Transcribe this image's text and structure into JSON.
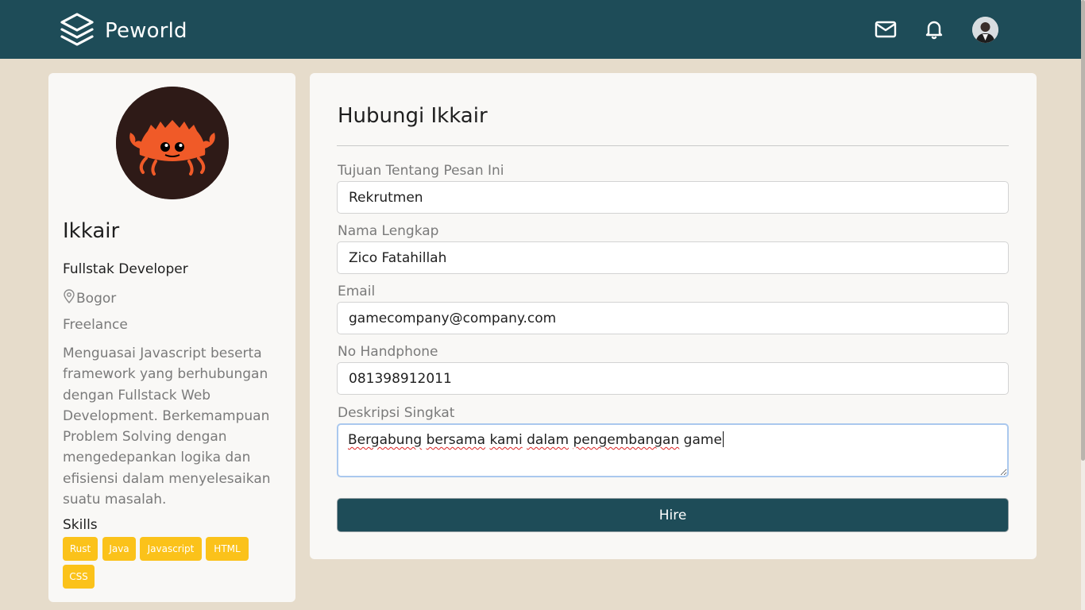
{
  "navbar": {
    "brand": "Peworld",
    "icons": [
      "layers-logo-icon",
      "mail-icon",
      "bell-icon",
      "user-avatar"
    ],
    "bg_color": "#1e4c58"
  },
  "profile": {
    "name": "Ikkair",
    "role": "Fullstak Developer",
    "location": "Bogor",
    "job_type": "Freelance",
    "bio": "Menguasai Javascript beserta framework yang berhubungan dengan Fullstack Web Development. Berkemampuan Problem Solving dengan mengedepankan logika dan efisiensi dalam menyelesaikan suatu masalah.",
    "skills_title": "Skills",
    "skills": [
      "Rust",
      "Java",
      "Javascript",
      "HTML",
      "CSS"
    ],
    "skill_color": "#fbc21a"
  },
  "contact": {
    "title": "Hubungi Ikkair",
    "fields": [
      {
        "label": "Tujuan Tentang Pesan Ini",
        "value": "Rekrutmen"
      },
      {
        "label": "Nama Lengkap",
        "value": "Zico Fatahillah"
      },
      {
        "label": "Email",
        "value": "gamecompany@company.com"
      },
      {
        "label": "No Handphone",
        "value": "081398912011"
      }
    ],
    "description": {
      "label": "Deskripsi Singkat",
      "words": [
        "Bergabung",
        "bersama",
        "kami",
        "dalam",
        "pengembangan",
        "game"
      ]
    },
    "button": "Hire"
  }
}
